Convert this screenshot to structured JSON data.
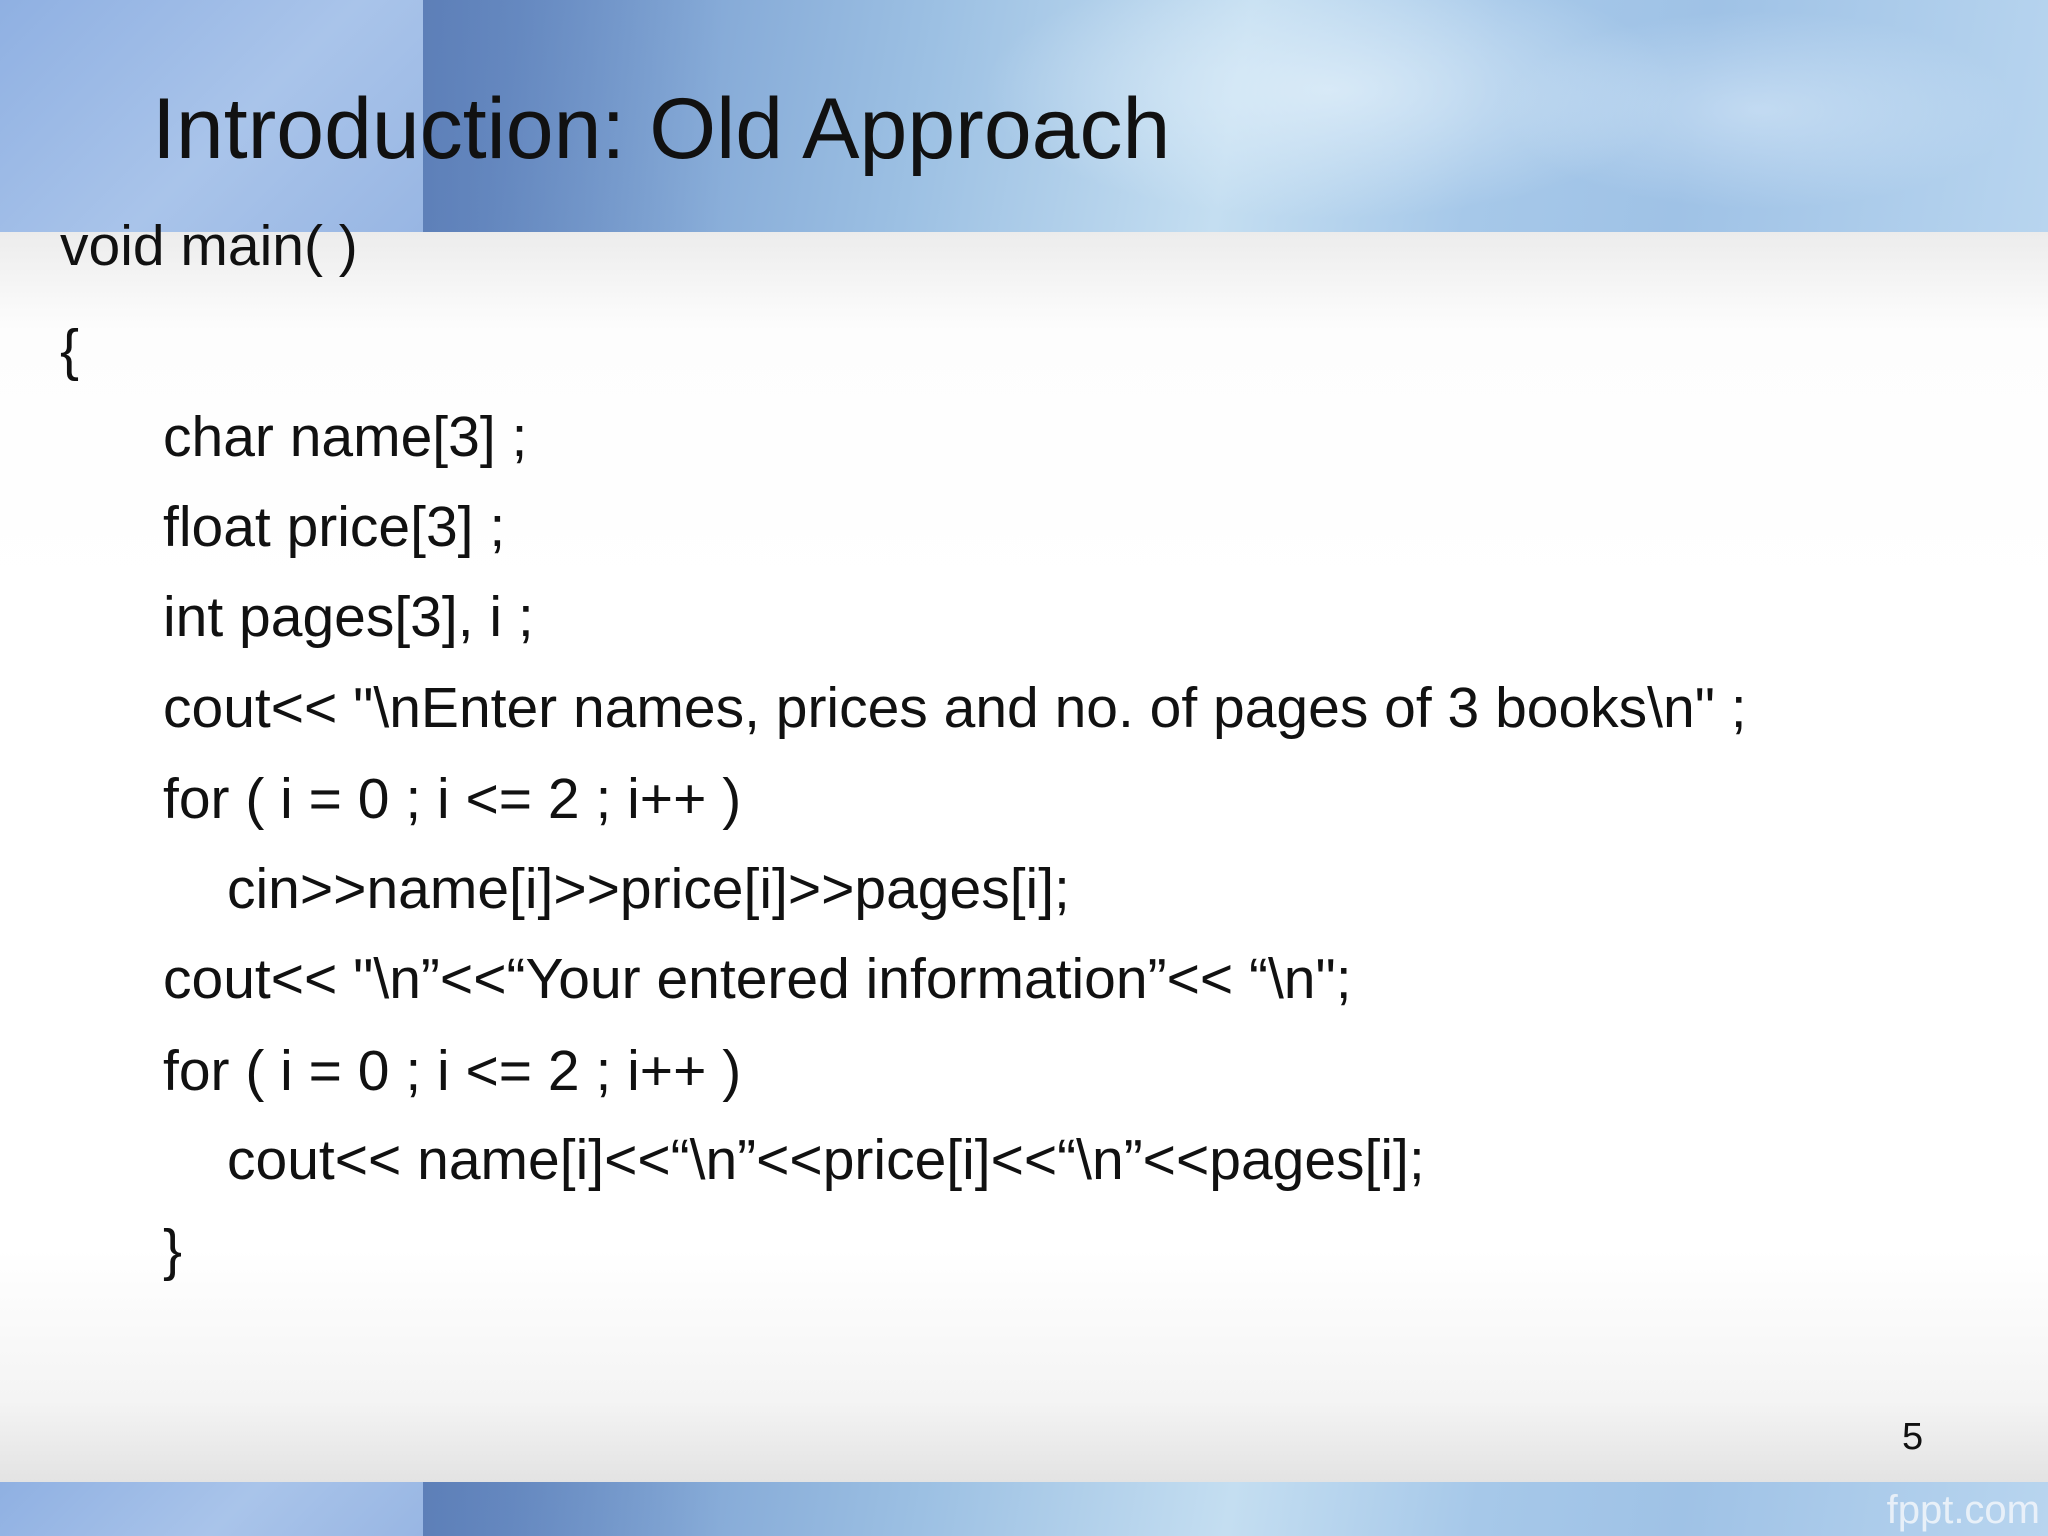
{
  "slide": {
    "title": "Introduction: Old Approach",
    "code_lines": [
      {
        "indent": 0,
        "text": "void main( )"
      },
      {
        "indent": 0,
        "text": "{"
      },
      {
        "indent": 1,
        "text": "char name[3] ;"
      },
      {
        "indent": 1,
        "text": "float price[3] ;"
      },
      {
        "indent": 1,
        "text": "int pages[3], i ;"
      },
      {
        "indent": 1,
        "text": "cout<< \"\\nEnter names, prices and no. of pages of 3 books\\n\" ;"
      },
      {
        "indent": 1,
        "text": "for ( i = 0 ; i <= 2 ; i++ )"
      },
      {
        "indent": 2,
        "text": "cin>>name[i]>>price[i]>>pages[i];"
      },
      {
        "indent": 1,
        "text": "cout<< \"\\n”<<“Your entered information”<< “\\n\";"
      },
      {
        "indent": 1,
        "text": "for ( i = 0 ; i <= 2 ; i++ )"
      },
      {
        "indent": 2,
        "text": "cout<< name[i]<<“\\n”<<price[i]<<“\\n”<<pages[i];"
      },
      {
        "indent": 1,
        "text": "}"
      }
    ],
    "page_number": "5",
    "watermark": "fppt.com"
  },
  "colors": {
    "text": "#111111",
    "banner_dark": "#5e7fbb",
    "banner_light": "#c4def1"
  }
}
